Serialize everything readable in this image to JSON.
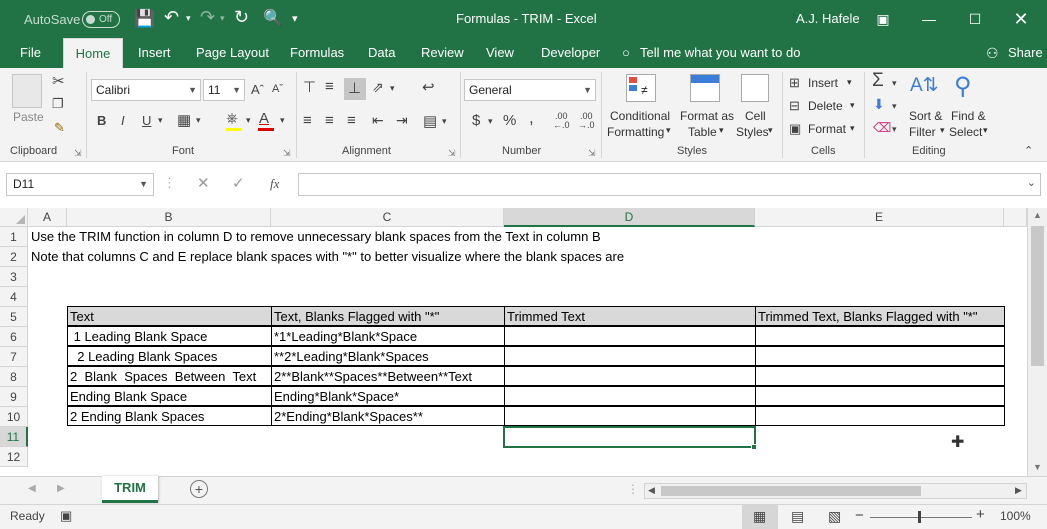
{
  "titlebar": {
    "autosave_label": "AutoSave",
    "autosave_state": "Off",
    "title": "Formulas - TRIM  -  Excel",
    "user": "A.J. Hafele"
  },
  "tabs": [
    "File",
    "Home",
    "Insert",
    "Page Layout",
    "Formulas",
    "Data",
    "Review",
    "View",
    "Developer"
  ],
  "tell_me": "Tell me what you want to do",
  "share": "Share",
  "ribbon": {
    "clipboard": {
      "paste": "Paste",
      "label": "Clipboard"
    },
    "font": {
      "name": "Calibri",
      "size": "11",
      "label": "Font",
      "bold": "B",
      "italic": "I",
      "underline": "U"
    },
    "alignment": {
      "label": "Alignment"
    },
    "number": {
      "format": "General",
      "label": "Number",
      "currency": "$",
      "percent": "%",
      "comma": ","
    },
    "styles": {
      "conditional": "Conditional",
      "formatting": "Formatting",
      "format_as": "Format as",
      "table": "Table",
      "cell": "Cell",
      "styles_btn": "Styles",
      "label": "Styles"
    },
    "cells": {
      "insert": "Insert",
      "delete": "Delete",
      "format": "Format",
      "label": "Cells"
    },
    "editing": {
      "sort": "Sort &",
      "filter": "Filter",
      "find": "Find &",
      "select": "Select",
      "label": "Editing"
    }
  },
  "formula_bar": {
    "name_box": "D11",
    "fx": "fx",
    "formula": ""
  },
  "columns": [
    "A",
    "B",
    "C",
    "D",
    "E"
  ],
  "rows": [
    "1",
    "2",
    "3",
    "4",
    "5",
    "6",
    "7",
    "8",
    "9",
    "10",
    "11",
    "12"
  ],
  "cells": {
    "r1": "Use the TRIM function in column D to remove unnecessary blank spaces from the Text in column B",
    "r2": "Note that columns C and E replace blank spaces with \"*\" to better visualize where the blank spaces are",
    "table": {
      "headers": [
        "Text",
        "Text, Blanks Flagged with \"*\"",
        "Trimmed Text",
        "Trimmed Text, Blanks Flagged with \"*\""
      ],
      "rows": [
        [
          " 1 Leading Blank Space",
          "*1*Leading*Blank*Space",
          "",
          ""
        ],
        [
          "  2 Leading Blank Spaces",
          "**2*Leading*Blank*Spaces",
          "",
          ""
        ],
        [
          "2  Blank  Spaces  Between  Text",
          "2**Blank**Spaces**Between**Text",
          "",
          ""
        ],
        [
          "Ending Blank Space",
          "Ending*Blank*Space*",
          "",
          ""
        ],
        [
          "2 Ending Blank Spaces",
          "2*Ending*Blank*Spaces**",
          "",
          ""
        ]
      ]
    }
  },
  "sheet_tab": "TRIM",
  "status": {
    "ready": "Ready",
    "zoom": "100%"
  },
  "colors": {
    "accent": "#217346",
    "ribbon_bg": "#f3f3f3",
    "header_bg": "#f3f3f3"
  }
}
